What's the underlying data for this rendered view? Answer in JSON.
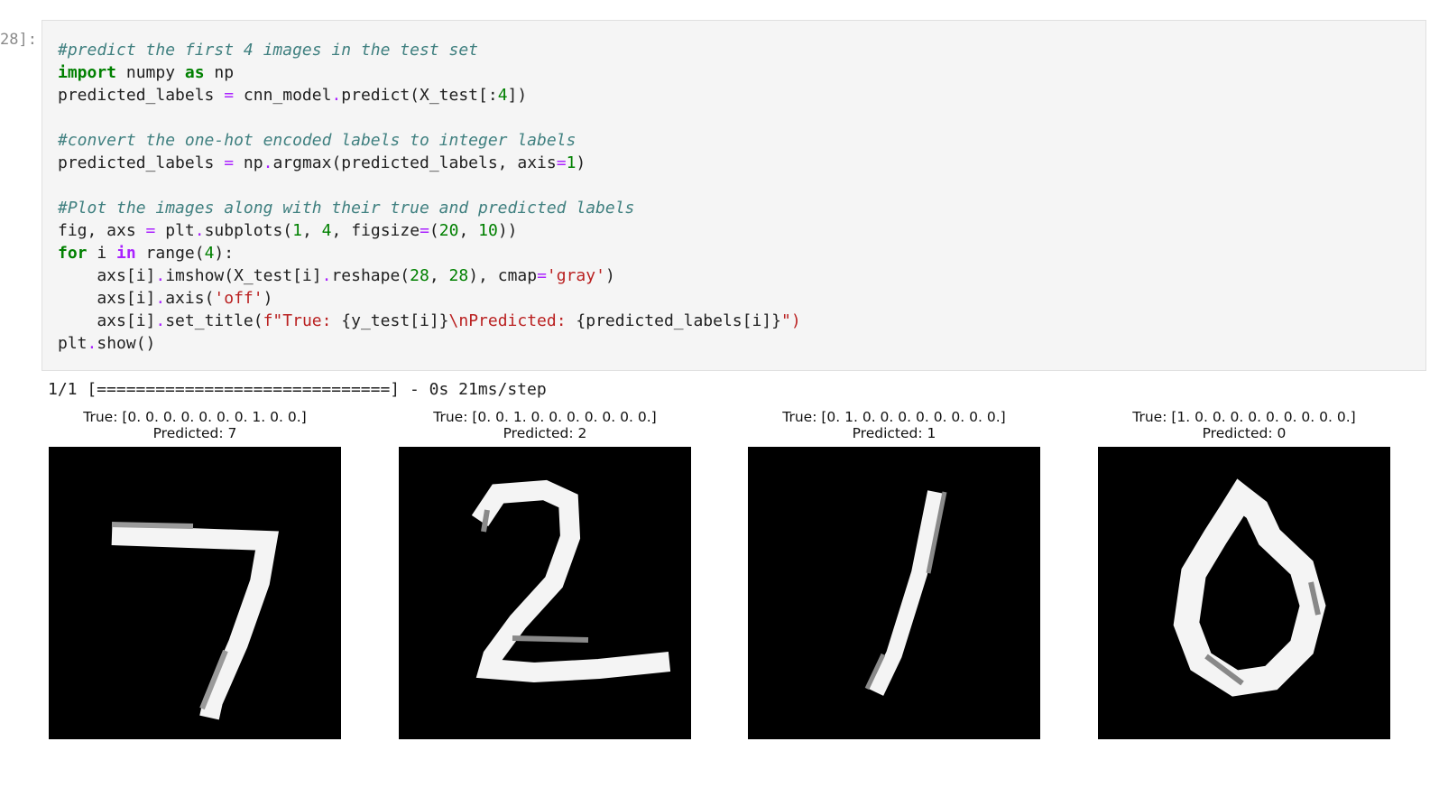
{
  "cell": {
    "prompt": "28]:",
    "code_lines": [
      [
        {
          "t": "#predict the first 4 images in the test set",
          "c": "cm"
        }
      ],
      [
        {
          "t": "import",
          "c": "kw"
        },
        {
          "t": " numpy "
        },
        {
          "t": "as",
          "c": "kw"
        },
        {
          "t": " np"
        }
      ],
      [
        {
          "t": "predicted_labels "
        },
        {
          "t": "=",
          "c": "op"
        },
        {
          "t": " cnn_model"
        },
        {
          "t": ".",
          "c": "op"
        },
        {
          "t": "predict(X_test[:"
        },
        {
          "t": "4",
          "c": "num"
        },
        {
          "t": "])"
        }
      ],
      [],
      [
        {
          "t": "#convert the one-hot encoded labels to integer labels",
          "c": "cm"
        }
      ],
      [
        {
          "t": "predicted_labels "
        },
        {
          "t": "=",
          "c": "op"
        },
        {
          "t": " np"
        },
        {
          "t": ".",
          "c": "op"
        },
        {
          "t": "argmax(predicted_labels, axis"
        },
        {
          "t": "=",
          "c": "op"
        },
        {
          "t": "1",
          "c": "num"
        },
        {
          "t": ")"
        }
      ],
      [],
      [
        {
          "t": "#Plot the images along with their true and predicted labels",
          "c": "cm"
        }
      ],
      [
        {
          "t": "fig, axs "
        },
        {
          "t": "=",
          "c": "op"
        },
        {
          "t": " plt"
        },
        {
          "t": ".",
          "c": "op"
        },
        {
          "t": "subplots("
        },
        {
          "t": "1",
          "c": "num"
        },
        {
          "t": ", "
        },
        {
          "t": "4",
          "c": "num"
        },
        {
          "t": ", figsize"
        },
        {
          "t": "=",
          "c": "op"
        },
        {
          "t": "("
        },
        {
          "t": "20",
          "c": "num"
        },
        {
          "t": ", "
        },
        {
          "t": "10",
          "c": "num"
        },
        {
          "t": "))"
        }
      ],
      [
        {
          "t": "for",
          "c": "kw"
        },
        {
          "t": " i "
        },
        {
          "t": "in",
          "c": "kw2"
        },
        {
          "t": " range("
        },
        {
          "t": "4",
          "c": "num"
        },
        {
          "t": "):"
        }
      ],
      [
        {
          "t": "    axs[i]"
        },
        {
          "t": ".",
          "c": "op"
        },
        {
          "t": "imshow(X_test[i]"
        },
        {
          "t": ".",
          "c": "op"
        },
        {
          "t": "reshape("
        },
        {
          "t": "28",
          "c": "num"
        },
        {
          "t": ", "
        },
        {
          "t": "28",
          "c": "num"
        },
        {
          "t": "), cmap"
        },
        {
          "t": "=",
          "c": "op"
        },
        {
          "t": "'gray'",
          "c": "str"
        },
        {
          "t": ")"
        }
      ],
      [
        {
          "t": "    axs[i]"
        },
        {
          "t": ".",
          "c": "op"
        },
        {
          "t": "axis("
        },
        {
          "t": "'off'",
          "c": "str"
        },
        {
          "t": ")"
        }
      ],
      [
        {
          "t": "    axs[i]"
        },
        {
          "t": ".",
          "c": "op"
        },
        {
          "t": "set_title("
        },
        {
          "t": "f\"True: ",
          "c": "str"
        },
        {
          "t": "{y_test[i]}"
        },
        {
          "t": "\\nPredicted: ",
          "c": "str"
        },
        {
          "t": "{predicted_labels[i]}"
        },
        {
          "t": "\")",
          "c": "str"
        }
      ],
      [
        {
          "t": "plt"
        },
        {
          "t": ".",
          "c": "op"
        },
        {
          "t": "show()"
        }
      ]
    ]
  },
  "output": {
    "progress_text": "1/1 [==============================] - 0s 21ms/step",
    "panels": [
      {
        "true_label": "True: [0. 0. 0. 0. 0. 0. 0. 1. 0. 0.]",
        "predicted": "Predicted: 7",
        "digit": "7"
      },
      {
        "true_label": "True: [0. 0. 1. 0. 0. 0. 0. 0. 0. 0.]",
        "predicted": "Predicted: 2",
        "digit": "2"
      },
      {
        "true_label": "True: [0. 1. 0. 0. 0. 0. 0. 0. 0. 0.]",
        "predicted": "Predicted: 1",
        "digit": "1"
      },
      {
        "true_label": "True: [1. 0. 0. 0. 0. 0. 0. 0. 0. 0.]",
        "predicted": "Predicted: 0",
        "digit": "0"
      }
    ]
  },
  "colors": {
    "cell_bg": "#f5f5f5",
    "keyword": "#008000",
    "comment": "#408080",
    "string": "#ba2121",
    "operator": "#aa22ff"
  }
}
